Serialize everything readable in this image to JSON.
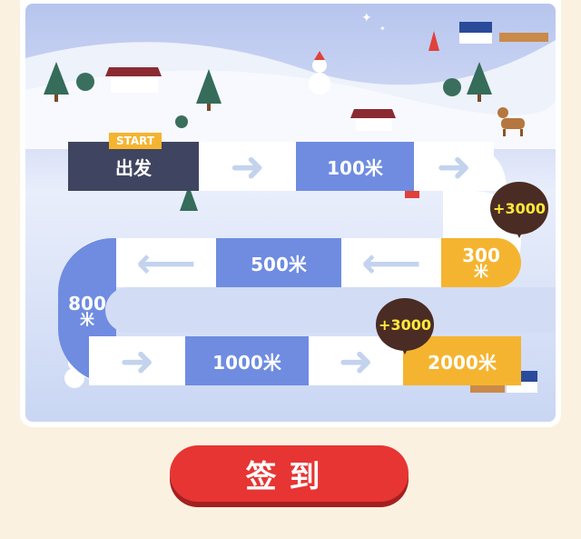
{
  "board": {
    "start_badge": "START",
    "start_label": "出发",
    "cells": {
      "c100": "100米",
      "c300_num": "300",
      "c300_unit": "米",
      "c500": "500米",
      "c800_num": "800",
      "c800_unit": "米",
      "c1000": "1000米",
      "c2000": "2000米"
    },
    "bonus_1": "+3000",
    "bonus_2": "+3000"
  },
  "arrows": {
    "right": "➜",
    "left": "⟵"
  },
  "signin_button": "签到",
  "colors": {
    "blue": "#6f8ce0",
    "orange": "#f5b430",
    "navy": "#3f4560",
    "red": "#e73533"
  }
}
